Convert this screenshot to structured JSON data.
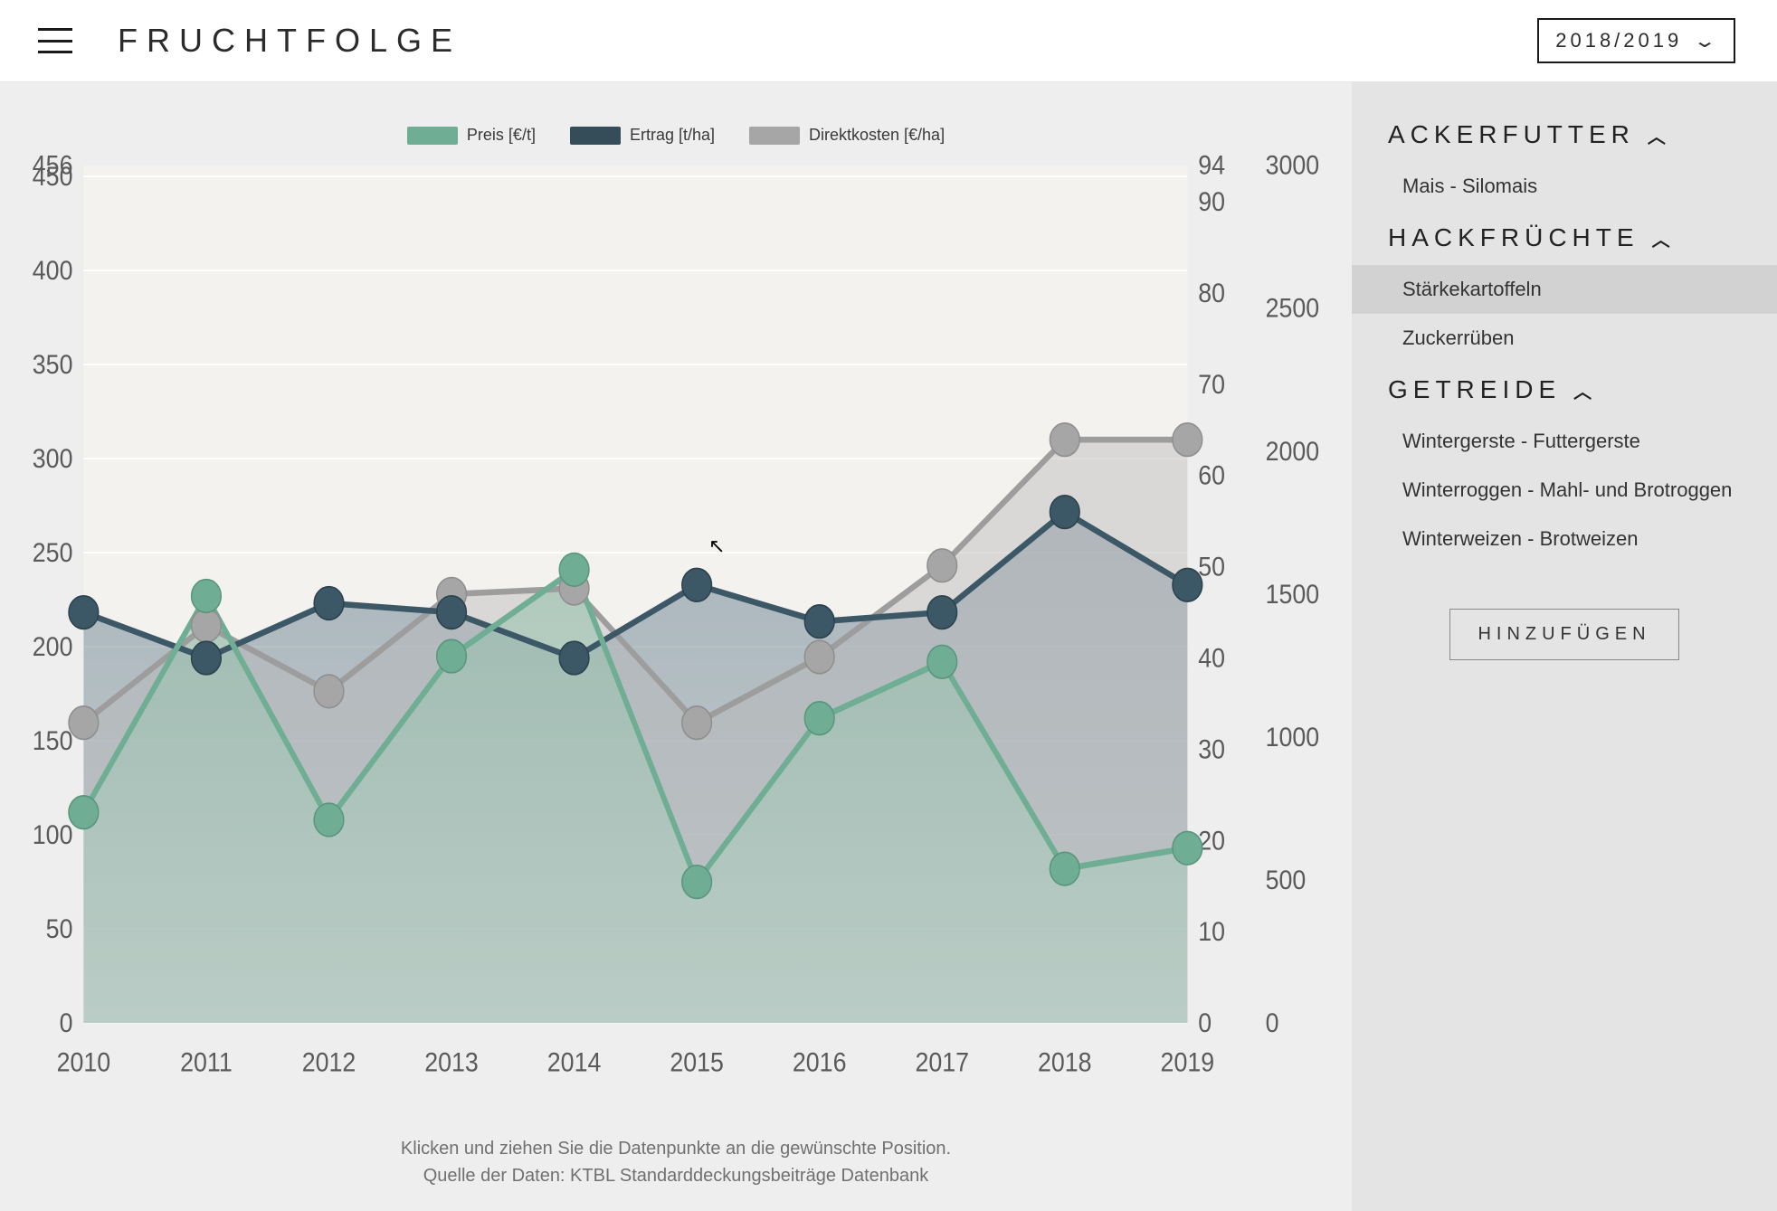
{
  "header": {
    "title": "FRUCHTFOLGE",
    "season": "2018/2019"
  },
  "sidebar": {
    "categories": [
      {
        "name": "ACKERFUTTER",
        "items": [
          "Mais - Silomais"
        ]
      },
      {
        "name": "HACKFRÜCHTE",
        "items": [
          "Stärkekartoffeln",
          "Zuckerrüben"
        ],
        "selected": "Stärkekartoffeln"
      },
      {
        "name": "GETREIDE",
        "items": [
          "Wintergerste - Futtergerste",
          "Winterroggen - Mahl- und Brotroggen",
          "Winterweizen - Brotweizen"
        ]
      }
    ],
    "add_button": "HINZUFÜGEN"
  },
  "chart_caption": {
    "line1": "Klicken und ziehen Sie die Datenpunkte an die gewünschte Position.",
    "line2": "Quelle der Daten: KTBL Standarddeckungsbeiträge Datenbank"
  },
  "chart_data": {
    "type": "line",
    "x": [
      2010,
      2011,
      2012,
      2013,
      2014,
      2015,
      2016,
      2017,
      2018,
      2019
    ],
    "series": [
      {
        "name": "Preis [€/t]",
        "axis": "y_left",
        "color": "#6fae94",
        "values": [
          112,
          227,
          108,
          195,
          241,
          75,
          162,
          192,
          82,
          93
        ]
      },
      {
        "name": "Ertrag [t/ha]",
        "axis": "y_right1",
        "color": "#3c5866",
        "values": [
          45,
          40,
          46,
          45,
          40,
          48,
          44,
          45,
          56,
          48
        ]
      },
      {
        "name": "Direktkosten [€/ha]",
        "axis": "y_right2",
        "color": "#a6a6a6",
        "values": [
          1050,
          1390,
          1160,
          1500,
          1520,
          1050,
          1280,
          1600,
          2040,
          2040
        ]
      }
    ],
    "axes": {
      "y_left": {
        "label": "",
        "range": [
          0,
          456
        ],
        "ticks": [
          0,
          50,
          100,
          150,
          200,
          250,
          300,
          350,
          400,
          450,
          456
        ]
      },
      "y_right1": {
        "label": "",
        "range": [
          0,
          94
        ],
        "ticks": [
          0,
          10,
          20,
          30,
          40,
          50,
          60,
          70,
          80,
          90,
          94
        ]
      },
      "y_right2": {
        "label": "",
        "range": [
          0,
          3000
        ],
        "ticks": [
          0,
          500,
          1000,
          1500,
          2000,
          2500,
          3000
        ]
      },
      "x": {
        "label": "",
        "ticks": [
          2010,
          2011,
          2012,
          2013,
          2014,
          2015,
          2016,
          2017,
          2018,
          2019
        ]
      }
    },
    "legend": [
      "Preis [€/t]",
      "Ertrag [t/ha]",
      "Direktkosten [€/ha]"
    ]
  }
}
